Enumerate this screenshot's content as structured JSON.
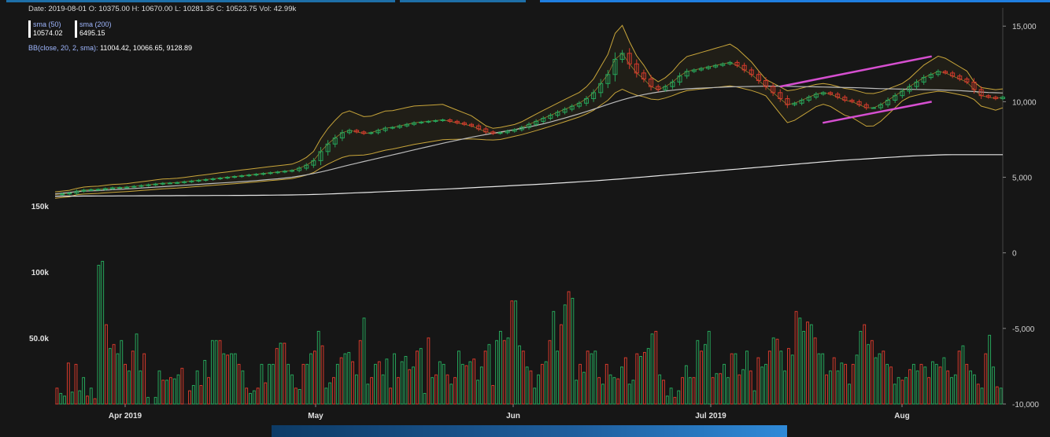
{
  "info": {
    "date_label": "Date:",
    "date": "2019-08-01",
    "o_label": "O:",
    "open": "10375.00",
    "h_label": "H:",
    "high": "10670.00",
    "l_label": "L:",
    "low": "10281.35",
    "c_label": "C:",
    "close": "10523.75",
    "vol_label": "Vol:",
    "vol": "42.99k"
  },
  "sma50": {
    "name": "sma (50)",
    "value": "10574.02"
  },
  "sma200": {
    "name": "sma (200)",
    "value": "6495.15"
  },
  "bb": {
    "name": "BB(close, 20, 2, sma):",
    "value": "11004.42, 10066.65, 9128.89"
  },
  "colors": {
    "up": "#26a65b",
    "down": "#d63a2c",
    "sma50": "#bbbbbb",
    "sma200": "#e6e6e6",
    "bb": "#c8a53a",
    "trendline": "#d64fd0",
    "background": "#161616"
  },
  "chart_data": {
    "type": "candlestick",
    "x_ticks": [
      "Apr 2019",
      "May",
      "Jun",
      "Jul 2019",
      "Aug"
    ],
    "y_right_ticks": [
      "15,000",
      "10,000",
      "5,000",
      "0",
      "-5,000",
      "-10,000"
    ],
    "y_left_ticks": [
      "150k",
      "100k",
      "50.0k"
    ],
    "price_ylim": [
      -10000,
      16000
    ],
    "volume_ylim": [
      0,
      160000
    ],
    "price": [
      3850,
      3900,
      3950,
      4080,
      4150,
      4180,
      4200,
      4250,
      4300,
      4320,
      4350,
      4400,
      4450,
      4500,
      4550,
      4600,
      4620,
      4650,
      4700,
      4750,
      4800,
      4850,
      4900,
      4950,
      5000,
      5050,
      5100,
      5150,
      5200,
      5250,
      5300,
      5350,
      5400,
      5450,
      5600,
      5800,
      6100,
      6700,
      7200,
      7600,
      7950,
      8100,
      8000,
      7900,
      7950,
      8100,
      8250,
      8300,
      8400,
      8500,
      8600,
      8650,
      8700,
      8750,
      8800,
      8700,
      8600,
      8500,
      8400,
      8200,
      8000,
      7900,
      7950,
      8050,
      8150,
      8300,
      8500,
      8700,
      8900,
      9100,
      9300,
      9500,
      9700,
      9900,
      10200,
      10600,
      11200,
      11800,
      12800,
      13200,
      12500,
      11900,
      11500,
      11000,
      10800,
      11000,
      11300,
      11700,
      12000,
      12100,
      12200,
      12300,
      12400,
      12500,
      12600,
      12400,
      12100,
      11800,
      11400,
      11000,
      10600,
      10200,
      9800,
      9900,
      10100,
      10300,
      10500,
      10600,
      10500,
      10300,
      10100,
      10000,
      9800,
      9600,
      9600,
      9800,
      10100,
      10400,
      10700,
      11000,
      11300,
      11600,
      11800,
      12000,
      11900,
      11700,
      11500,
      11300,
      10800,
      10400,
      10300,
      10200,
      10300
    ],
    "sma50": [
      3900,
      3950,
      4000,
      4050,
      4080,
      4100,
      4120,
      4150,
      4180,
      4200,
      4230,
      4260,
      4290,
      4320,
      4350,
      4380,
      4410,
      4440,
      4470,
      4500,
      4530,
      4560,
      4590,
      4620,
      4650,
      4680,
      4710,
      4740,
      4780,
      4820,
      4860,
      4900,
      4950,
      5000,
      5080,
      5160,
      5250,
      5350,
      5460,
      5580,
      5700,
      5820,
      5930,
      6040,
      6150,
      6260,
      6370,
      6480,
      6590,
      6700,
      6810,
      6920,
      7030,
      7140,
      7250,
      7350,
      7450,
      7550,
      7650,
      7740,
      7830,
      7910,
      7990,
      8070,
      8150,
      8240,
      8330,
      8430,
      8540,
      8660,
      8790,
      8920,
      9060,
      9200,
      9350,
      9500,
      9660,
      9820,
      9980,
      10120,
      10250,
      10370,
      10470,
      10560,
      10640,
      10700,
      10760,
      10810,
      10850,
      10880,
      10900,
      10920,
      10940,
      10960,
      10980,
      10990,
      11000,
      11010,
      11020,
      11030,
      11030,
      11030,
      11020,
      11010,
      11000,
      10990,
      10980,
      10970,
      10960,
      10950,
      10940,
      10930,
      10920,
      10900,
      10880,
      10860,
      10850,
      10840,
      10830,
      10820,
      10810,
      10800,
      10790,
      10780,
      10770,
      10760,
      10730,
      10700,
      10670,
      10640,
      10610,
      10590,
      10574
    ],
    "sma200": [
      3750,
      3752,
      3754,
      3756,
      3758,
      3760,
      3762,
      3764,
      3766,
      3768,
      3770,
      3772,
      3774,
      3776,
      3778,
      3780,
      3782,
      3784,
      3786,
      3788,
      3790,
      3792,
      3794,
      3796,
      3798,
      3800,
      3802,
      3804,
      3808,
      3812,
      3816,
      3820,
      3826,
      3832,
      3840,
      3850,
      3862,
      3876,
      3892,
      3910,
      3930,
      3950,
      3970,
      3990,
      4010,
      4030,
      4050,
      4070,
      4090,
      4110,
      4130,
      4150,
      4170,
      4190,
      4210,
      4230,
      4255,
      4280,
      4305,
      4330,
      4355,
      4380,
      4405,
      4430,
      4455,
      4480,
      4505,
      4530,
      4555,
      4580,
      4610,
      4640,
      4670,
      4700,
      4730,
      4760,
      4795,
      4830,
      4865,
      4900,
      4940,
      4980,
      5020,
      5060,
      5100,
      5140,
      5180,
      5220,
      5260,
      5300,
      5340,
      5380,
      5420,
      5460,
      5500,
      5540,
      5580,
      5620,
      5660,
      5700,
      5740,
      5780,
      5820,
      5860,
      5900,
      5940,
      5980,
      6020,
      6060,
      6100,
      6130,
      6160,
      6190,
      6220,
      6250,
      6280,
      6310,
      6340,
      6370,
      6400,
      6420,
      6440,
      6460,
      6480,
      6490,
      6493,
      6494,
      6495,
      6495,
      6495,
      6495,
      6495,
      6495
    ],
    "volume": [
      12000,
      8000,
      6000,
      31000,
      9000,
      30000,
      10000,
      20000,
      6000,
      12000,
      4000,
      105000,
      108000,
      60000,
      42000,
      45000,
      38000,
      48000,
      30000,
      25000,
      40000,
      53000,
      25000,
      38000,
      5000,
      0,
      5000,
      25000,
      18000,
      18000,
      20000,
      19000,
      22000,
      27000,
      0,
      10000,
      14000,
      25000,
      14000,
      33000,
      20000,
      48000,
      48000,
      48000,
      38000,
      37000,
      38000,
      38000,
      30000,
      25000,
      12000,
      8000,
      10000,
      12000,
      30000,
      16000,
      30000,
      30000,
      42000,
      46000,
      46000,
      30000,
      22000,
      12000,
      11000,
      30000,
      30000,
      38000,
      40000,
      55000,
      44000,
      12000,
      16000,
      20000,
      30000,
      35000,
      38000,
      39000,
      32000,
      22000,
      48000,
      65000,
      15000,
      20000,
      30000,
      32000,
      22000,
      34000,
      12000,
      38000,
      20000,
      32000,
      36000,
      26000,
      28000,
      40000,
      42000,
      8000,
      50000,
      20000,
      22000,
      32000,
      30000,
      22000,
      15000,
      20000,
      40000,
      30000,
      29000,
      32000,
      34000,
      18000,
      28000,
      40000,
      45000,
      14000,
      48000,
      55000,
      48000,
      50000,
      78000,
      78000,
      44000,
      40000,
      28000,
      25000,
      12000,
      22000,
      30000,
      32000,
      48000,
      70000,
      40000,
      60000,
      75000,
      85000,
      80000,
      18000,
      30000,
      24000,
      40000,
      38000,
      40000,
      20000,
      15000,
      30000,
      22000,
      20000,
      19000,
      28000,
      35000,
      15000,
      18000,
      38000,
      36000,
      39000,
      42000,
      53000,
      55000,
      22000,
      18000,
      6000,
      12000,
      5000,
      10000,
      20000,
      29000,
      20000,
      20000,
      48000,
      40000,
      45000,
      55000,
      20000,
      23000,
      23000,
      30000,
      20000,
      38000,
      38000,
      22000,
      26000,
      40000,
      25000,
      10000,
      35000,
      28000,
      30000,
      40000,
      50000,
      49000,
      40000,
      25000,
      42000,
      37000,
      70000,
      65000,
      55000,
      62000,
      60000,
      50000,
      38000,
      38000,
      22000,
      25000,
      35000,
      25000,
      31000,
      30000,
      15000,
      30000,
      37000,
      55000,
      60000,
      45000,
      48000,
      35000,
      38000,
      40000,
      30000,
      28000,
      15000,
      20000,
      18000,
      20000,
      26000,
      30000,
      25000,
      30000,
      28000,
      20000,
      32000,
      30000,
      28000,
      35000,
      25000,
      20000,
      22000,
      40000,
      44000,
      30000,
      25000,
      22000,
      15000,
      12000,
      38000,
      52000,
      28000,
      13000,
      12000
    ],
    "trendlines": [
      {
        "from": [
          0.765,
          11000
        ],
        "to": [
          0.925,
          13000
        ]
      },
      {
        "from": [
          0.81,
          8600
        ],
        "to": [
          0.925,
          10000
        ]
      }
    ]
  }
}
